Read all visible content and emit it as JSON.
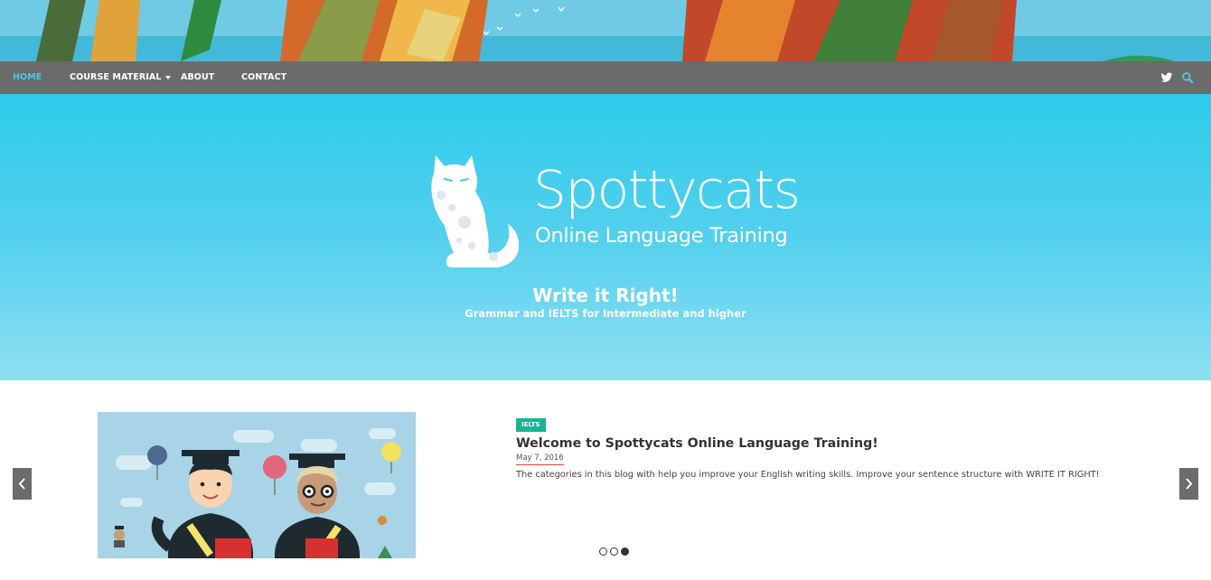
{
  "nav": {
    "items": [
      {
        "label": "HOME",
        "active": true
      },
      {
        "label": "COURSE MATERIAL",
        "has_dropdown": true
      },
      {
        "label": "ABOUT"
      },
      {
        "label": "CONTACT"
      }
    ],
    "icons": [
      "twitter-icon",
      "search-icon"
    ]
  },
  "hero": {
    "logo_title": "Spottycats",
    "logo_subtitle": "Online Language Training",
    "heading": "Write it Right!",
    "tagline": "Grammar and IELTS for Intermediate and higher"
  },
  "slider": {
    "category": "IELTS",
    "title": "Welcome to Spottycats Online Language Training!",
    "date": "May 7, 2016",
    "excerpt": "The categories in this blog with help you improve your English writing skills. Improve your sentence structure with WRITE IT RIGHT!",
    "slide_count": 3,
    "active_slide": 3
  },
  "colors": {
    "nav_bg": "#6b6b6b",
    "nav_active": "#4cc7ea",
    "hero_top": "#2ecbea",
    "hero_bottom": "#8ee0f2",
    "badge": "#1bb393"
  }
}
